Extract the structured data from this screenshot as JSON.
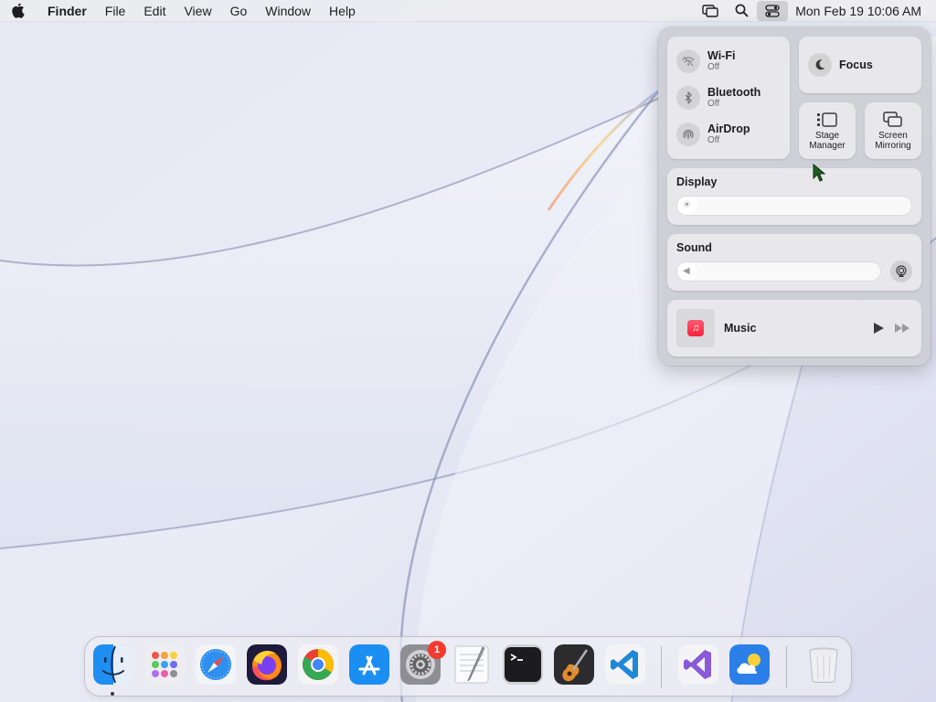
{
  "menubar": {
    "app_name": "Finder",
    "menus": [
      "File",
      "Edit",
      "View",
      "Go",
      "Window",
      "Help"
    ],
    "clock": "Mon Feb 19  10:06 AM",
    "icons": [
      "screen-mirroring-icon",
      "spotlight-search-icon",
      "control-center-icon"
    ]
  },
  "control_center": {
    "wifi": {
      "label": "Wi-Fi",
      "status": "Off"
    },
    "bluetooth": {
      "label": "Bluetooth",
      "status": "Off"
    },
    "airdrop": {
      "label": "AirDrop",
      "status": "Off"
    },
    "focus": {
      "label": "Focus"
    },
    "stage_manager": {
      "label_line1": "Stage",
      "label_line2": "Manager"
    },
    "screen_mirroring": {
      "label_line1": "Screen",
      "label_line2": "Mirroring"
    },
    "display": {
      "title": "Display",
      "level": 0.05
    },
    "sound": {
      "title": "Sound",
      "level": 0.03
    },
    "music": {
      "title": "Music"
    }
  },
  "dock": {
    "apps": [
      "Finder",
      "Launchpad",
      "Safari",
      "Firefox",
      "Google Chrome",
      "App Store",
      "System Settings",
      "TextEdit",
      "Terminal",
      "GarageBand",
      "Visual Studio Code",
      "Visual Studio",
      "Weather",
      "Trash"
    ],
    "system_settings_badge": "1"
  },
  "colors": {
    "accent_red": "#f23b30",
    "music_red": "#fa233b",
    "cursor_green": "#1f5f1f"
  }
}
